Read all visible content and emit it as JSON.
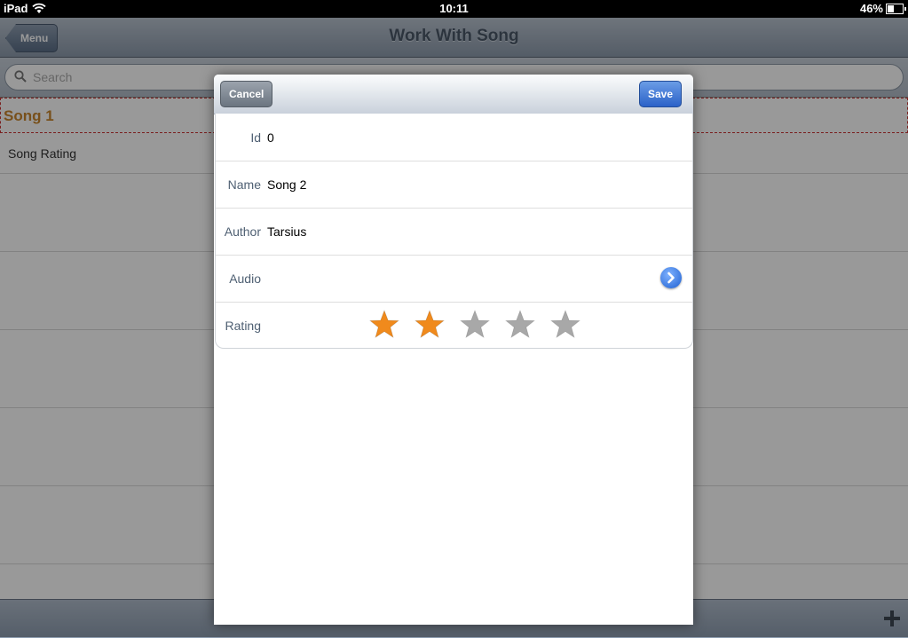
{
  "status": {
    "device": "iPad",
    "time": "10:11",
    "battery": "46%"
  },
  "nav": {
    "back_label": "Menu",
    "title": "Work With Song"
  },
  "search": {
    "placeholder": "Search"
  },
  "list": {
    "items": [
      "Song 1",
      "Song Rating"
    ]
  },
  "modal": {
    "cancel_label": "Cancel",
    "save_label": "Save",
    "fields": {
      "id": {
        "label": "Id",
        "value": "0"
      },
      "name": {
        "label": "Name",
        "value": "Song 2"
      },
      "author": {
        "label": "Author",
        "value": "Tarsius"
      },
      "audio": {
        "label": "Audio"
      },
      "rating": {
        "label": "Rating",
        "value": 2,
        "max": 5
      }
    }
  },
  "colors": {
    "star_on": "#f08a1c",
    "star_off": "#a8a8a8",
    "save": "#2b62c8"
  },
  "icons": [
    "wifi-icon",
    "battery-icon",
    "search-icon",
    "add-icon",
    "disclosure-icon",
    "star-icon"
  ]
}
